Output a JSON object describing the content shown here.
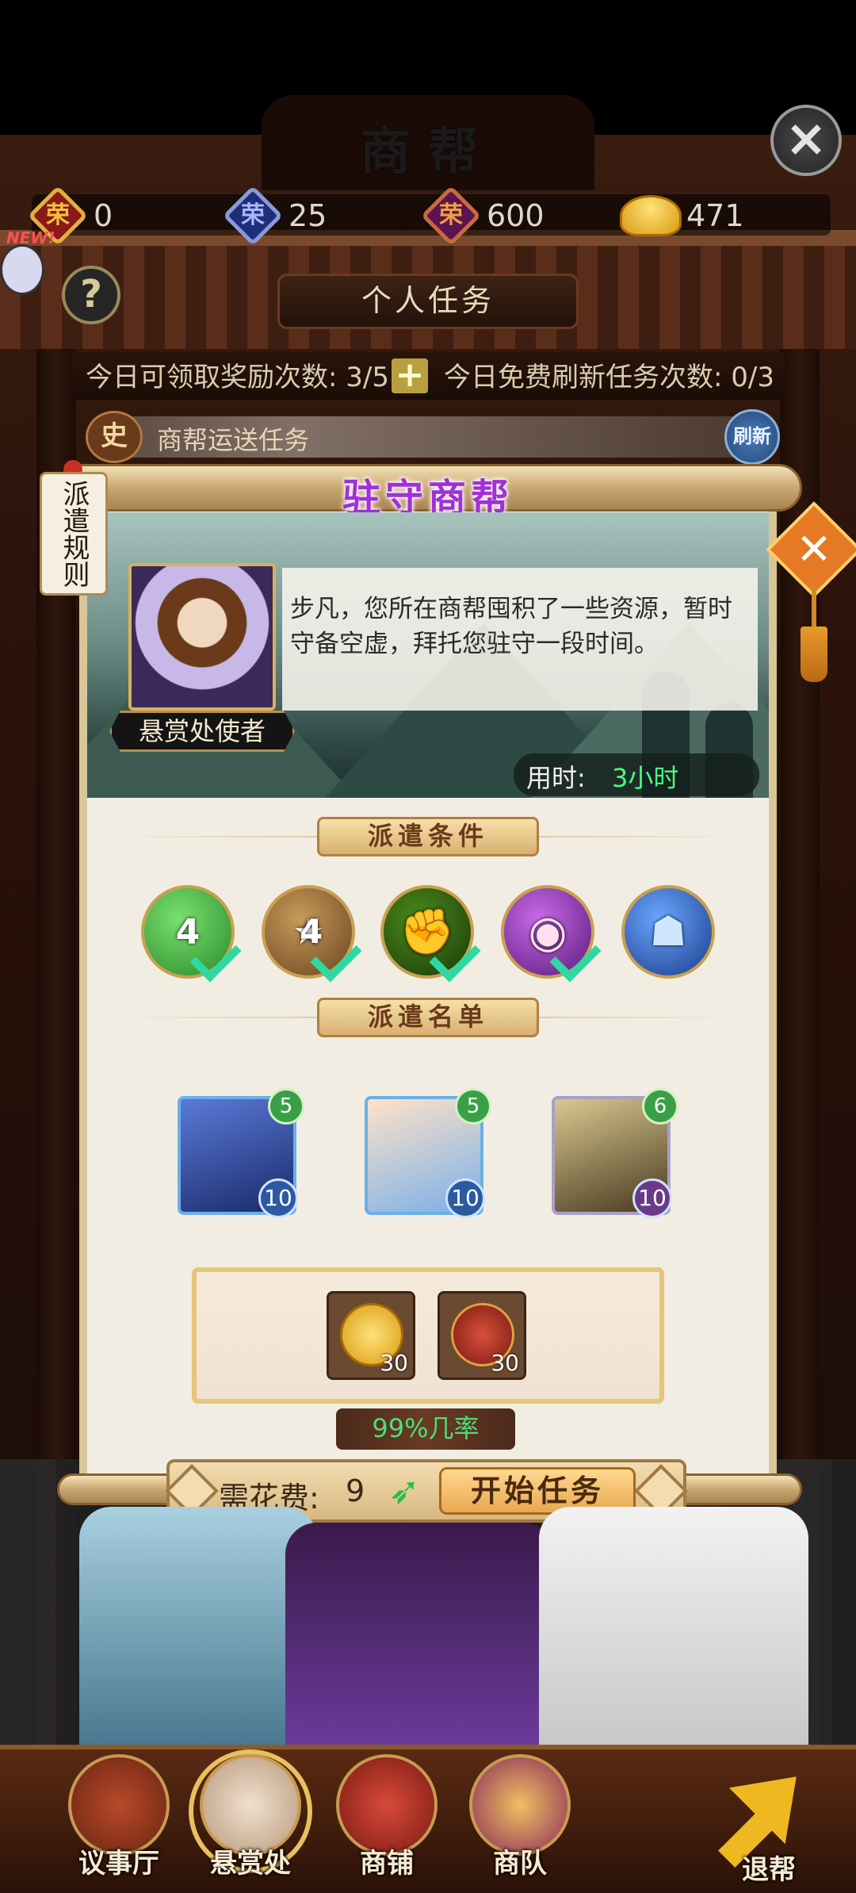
{
  "header": {
    "title": "商帮"
  },
  "currencies": [
    {
      "icon": "glory-gold-icon",
      "symbol": "荣",
      "value": "0",
      "color": "#c0392b"
    },
    {
      "icon": "glory-blue-icon",
      "symbol": "荣",
      "value": "25",
      "color": "#2a3f8f"
    },
    {
      "icon": "glory-purple-icon",
      "symbol": "荣",
      "value": "600",
      "color": "#7a1f6a"
    },
    {
      "icon": "gold-ingot-icon",
      "value": "471"
    }
  ],
  "new_badge": "NEW!",
  "help_symbol": "?",
  "tabs": {
    "personal": "个人任务"
  },
  "quotas": {
    "claim": "今日可领取奖励次数: 3/5",
    "plus": "+",
    "refresh": "今日免费刷新任务次数: 0/3"
  },
  "task": {
    "badge": "史",
    "label": "商帮运送任务",
    "refresh": "刷新"
  },
  "modal": {
    "title": "驻守商帮",
    "rule_tab": "派遣规则",
    "npc_name": "悬赏处使者",
    "dialog": "步凡，您所在商帮囤积了一些资源，暂时守备空虚，拜托您驻守一段时间。",
    "time_label": "用时:",
    "time_value": "3小时",
    "conditions_title": "派遣条件",
    "conditions": [
      {
        "icon": "green-orb-icon",
        "value": "4",
        "met": true,
        "color": "#3aa83a"
      },
      {
        "icon": "star-icon",
        "value": "4",
        "met": true,
        "color": "#f2b52a"
      },
      {
        "icon": "fist-icon",
        "value": "",
        "met": true,
        "color": "#4a8a1a"
      },
      {
        "icon": "eye-icon",
        "value": "",
        "met": true,
        "color": "#8a2ab8"
      },
      {
        "icon": "blue-mask-icon",
        "value": "",
        "met": false,
        "color": "#2a6ad8"
      }
    ],
    "roster_title": "派遣名单",
    "heroes": [
      {
        "name": "hero-brown-hair",
        "stars": "5",
        "level": "10",
        "color": "#3a5aa8"
      },
      {
        "name": "hero-blonde",
        "stars": "5",
        "level": "10",
        "color": "#6aa8e8"
      },
      {
        "name": "hero-lion-warrior",
        "stars": "6",
        "level": "10",
        "color": "#6a5a30"
      }
    ],
    "rewards": [
      {
        "icon": "gold-coin-icon",
        "qty": "30",
        "color": "#f0b82a"
      },
      {
        "icon": "glory-coin-icon",
        "qty": "30",
        "color": "#b83a2a"
      }
    ],
    "success_rate": "99%几率",
    "cost_label": "需花费:",
    "cost_value": "9",
    "start_button": "开始任务"
  },
  "nav": [
    {
      "label": "议事厅",
      "icon": "council-hall-icon"
    },
    {
      "label": "悬赏处",
      "icon": "bounty-icon"
    },
    {
      "label": "商铺",
      "icon": "shop-icon"
    },
    {
      "label": "商队",
      "icon": "caravan-icon"
    },
    {
      "label": "退帮",
      "icon": "exit-arrow-icon"
    }
  ]
}
